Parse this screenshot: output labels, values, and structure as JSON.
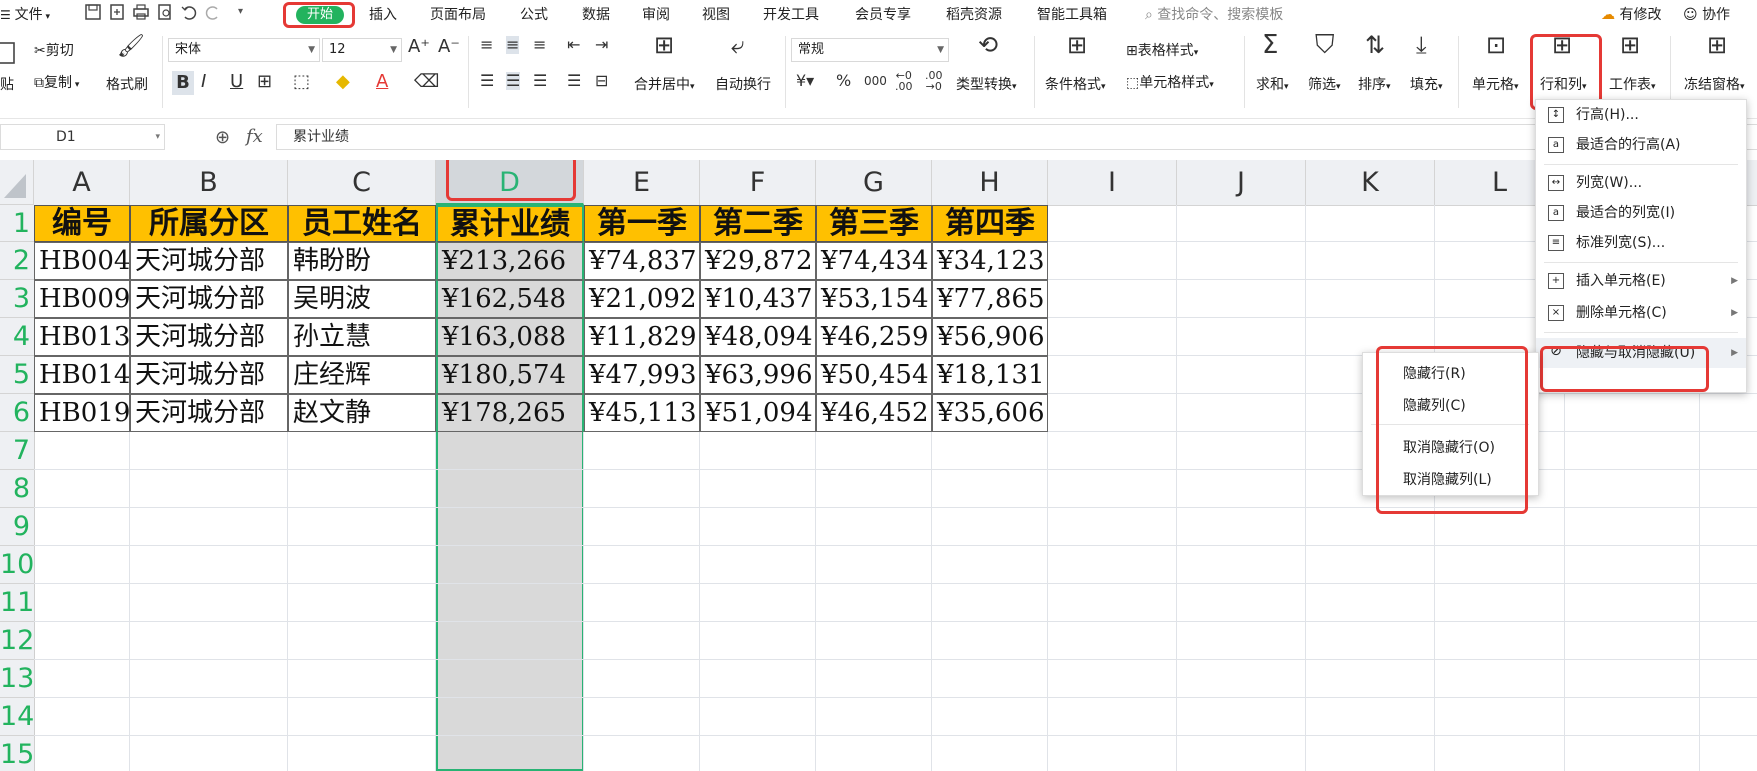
{
  "menubar": {
    "file": "文件",
    "tabs": [
      "开始",
      "插入",
      "页面布局",
      "公式",
      "数据",
      "审阅",
      "视图",
      "开发工具",
      "会员专享",
      "稻壳资源",
      "智能工具箱"
    ],
    "search_placeholder": "查找命令、搜索模板",
    "modified": "有修改",
    "collab": "协作"
  },
  "ribbon": {
    "cut": "剪切",
    "paste": "贴",
    "copy": "复制",
    "format_painter": "格式刷",
    "font_name": "宋体",
    "font_size": "12",
    "merge_center": "合并居中",
    "wrap_text": "自动换行",
    "number_format": "常规",
    "type_convert": "类型转换",
    "cond_format": "条件格式",
    "table_style": "表格样式",
    "cell_style": "单元格样式",
    "sum": "求和",
    "filter": "筛选",
    "sort": "排序",
    "fill": "填充",
    "cell": "单元格",
    "row_col": "行和列",
    "worksheet": "工作表",
    "freeze": "冻结窗格"
  },
  "formula_bar": {
    "name_box": "D1",
    "fx": "fx",
    "content": "累计业绩"
  },
  "columns": [
    "A",
    "B",
    "C",
    "D",
    "E",
    "F",
    "G",
    "H",
    "I",
    "J",
    "K",
    "L"
  ],
  "row_numbers": [
    "1",
    "2",
    "3",
    "4",
    "5",
    "6",
    "7",
    "8",
    "9",
    "10",
    "11",
    "12",
    "13",
    "14",
    "15"
  ],
  "table": {
    "headers": [
      "编号",
      "所属分区",
      "员工姓名",
      "累计业绩",
      "第一季",
      "第二季",
      "第三季",
      "第四季"
    ],
    "rows": [
      [
        "HB004",
        "天河城分部",
        "韩盼盼",
        "¥213,266",
        "¥74,837",
        "¥29,872",
        "¥74,434",
        "¥34,123"
      ],
      [
        "HB009",
        "天河城分部",
        "吴明波",
        "¥162,548",
        "¥21,092",
        "¥10,437",
        "¥53,154",
        "¥77,865"
      ],
      [
        "HB013",
        "天河城分部",
        "孙立慧",
        "¥163,088",
        "¥11,829",
        "¥48,094",
        "¥46,259",
        "¥56,906"
      ],
      [
        "HB014",
        "天河城分部",
        "庄经辉",
        "¥180,574",
        "¥47,993",
        "¥63,996",
        "¥50,454",
        "¥18,131"
      ],
      [
        "HB019",
        "天河城分部",
        "赵文静",
        "¥178,265",
        "¥45,113",
        "¥51,094",
        "¥46,452",
        "¥35,606"
      ]
    ]
  },
  "row_col_menu": {
    "items": [
      {
        "label": "行高(H)...",
        "icon": "row-height-icon"
      },
      {
        "label": "最适合的行高(A)",
        "icon": "autofit-row-icon"
      },
      {
        "label": "列宽(W)...",
        "icon": "col-width-icon"
      },
      {
        "label": "最适合的列宽(I)",
        "icon": "autofit-col-icon"
      },
      {
        "label": "标准列宽(S)...",
        "icon": "std-width-icon"
      },
      {
        "label": "插入单元格(E)",
        "icon": "insert-cell-icon"
      },
      {
        "label": "删除单元格(C)",
        "icon": "delete-cell-icon"
      },
      {
        "label": "隐藏与取消隐藏(U)",
        "icon": "eye-hide-icon"
      }
    ]
  },
  "hide_submenu": {
    "items": [
      "隐藏行(R)",
      "隐藏列(C)",
      "取消隐藏行(O)",
      "取消隐藏列(L)"
    ]
  },
  "colors": {
    "accent_green": "#22b35e",
    "highlight_red": "#e53935",
    "header_fill": "#ffc000",
    "selection_green": "#29b374"
  }
}
